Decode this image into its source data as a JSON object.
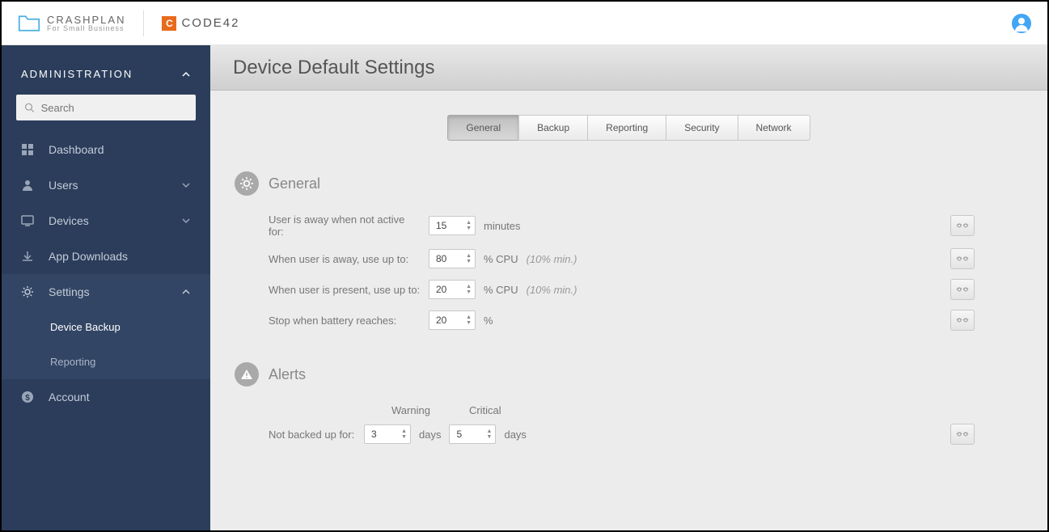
{
  "header": {
    "crashplan_title": "CRASHPLAN",
    "crashplan_sub": "For Small Business",
    "code42_label": "CODE42"
  },
  "sidebar": {
    "section": "ADMINISTRATION",
    "search_placeholder": "Search",
    "items": [
      {
        "label": "Dashboard",
        "icon": "dashboard"
      },
      {
        "label": "Users",
        "icon": "user",
        "expandable": true
      },
      {
        "label": "Devices",
        "icon": "monitor",
        "expandable": true
      },
      {
        "label": "App Downloads",
        "icon": "download"
      },
      {
        "label": "Settings",
        "icon": "gear",
        "expandable": true,
        "expanded": true,
        "children": [
          {
            "label": "Device Backup",
            "active": true
          },
          {
            "label": "Reporting"
          }
        ]
      },
      {
        "label": "Account",
        "icon": "dollar"
      }
    ]
  },
  "page": {
    "title": "Device Default Settings",
    "tabs": [
      "General",
      "Backup",
      "Reporting",
      "Security",
      "Network"
    ],
    "active_tab": "General"
  },
  "general": {
    "heading": "General",
    "rows": {
      "away_label": "User is away when not active for:",
      "away_value": "15",
      "away_unit": "minutes",
      "cpu_away_label": "When user is away, use up to:",
      "cpu_away_value": "80",
      "cpu_away_unit": "% CPU",
      "cpu_away_hint": "(10% min.)",
      "cpu_present_label": "When user is present, use up to:",
      "cpu_present_value": "20",
      "cpu_present_unit": "% CPU",
      "cpu_present_hint": "(10% min.)",
      "battery_label": "Stop when battery reaches:",
      "battery_value": "20",
      "battery_unit": "%"
    }
  },
  "alerts": {
    "heading": "Alerts",
    "col_warning": "Warning",
    "col_critical": "Critical",
    "row_label": "Not backed up for:",
    "warning_value": "3",
    "warning_unit": "days",
    "critical_value": "5",
    "critical_unit": "days"
  }
}
